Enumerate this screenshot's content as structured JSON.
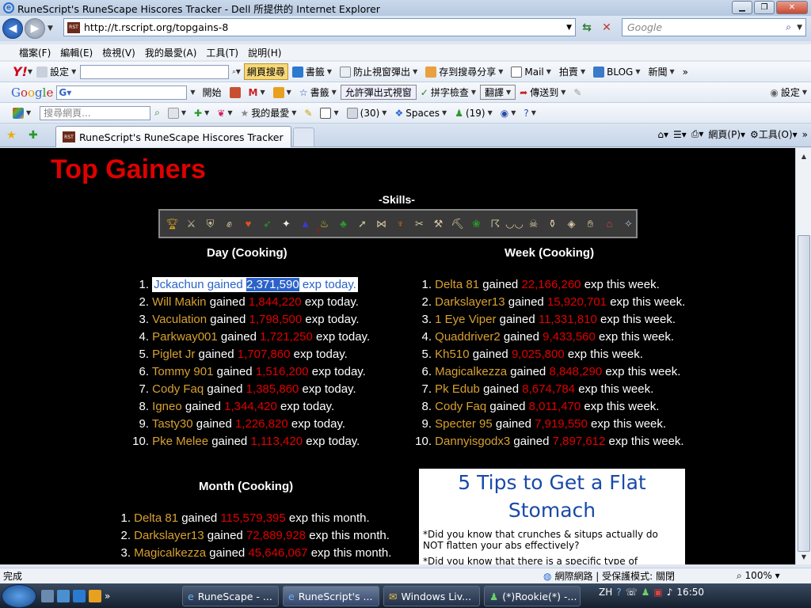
{
  "window": {
    "title": "RuneScript's RuneScape Hiscores Tracker - Dell 所提供的 Internet Explorer"
  },
  "address": {
    "url": "http://t.rscript.org/topgains-8",
    "search_placeholder": "Google"
  },
  "menu": [
    "檔案(F)",
    "編輯(E)",
    "檢視(V)",
    "我的最愛(A)",
    "工具(T)",
    "說明(H)"
  ],
  "toolbar1": {
    "settings": "設定",
    "search_btn": "網頁搜尋",
    "bookmarks": "書籤",
    "popup": "防止視窗彈出",
    "save_search": "存到搜尋分享",
    "mail": "Mail",
    "auction": "拍賣",
    "blog": "BLOG",
    "news": "新聞"
  },
  "toolbar2": {
    "go": "開始",
    "bookmarks": "書籤",
    "allow_popup": "允許彈出式視窗",
    "spell": "拼字檢查",
    "translate": "翻譯",
    "send": "傳送到",
    "settings": "設定"
  },
  "toolbar3": {
    "search_placeholder": "搜尋網頁...",
    "favorites": "我的最愛",
    "count1": "(30)",
    "spaces": "Spaces",
    "count2": "(19)"
  },
  "tab": {
    "title": "RuneScript's RuneScape Hiscores Tracker"
  },
  "cmdbar": {
    "page": "網頁(P)",
    "tools": "工具(O)"
  },
  "page": {
    "title": "Top Gainers",
    "skills_label": "-Skills-",
    "day": {
      "heading": "Day (Cooking)",
      "rows": [
        {
          "n": "1.",
          "name": "Jckachun",
          "val": "2,371,590",
          "suffix": "exp today."
        },
        {
          "n": "2.",
          "name": "Will Makin",
          "val": "1,844,220",
          "suffix": "exp today."
        },
        {
          "n": "3.",
          "name": "Vaculation",
          "val": "1,798,500",
          "suffix": "exp today."
        },
        {
          "n": "4.",
          "name": "Parkway001",
          "val": "1,721,250",
          "suffix": "exp today."
        },
        {
          "n": "5.",
          "name": "Piglet Jr",
          "val": "1,707,860",
          "suffix": "exp today."
        },
        {
          "n": "6.",
          "name": "Tommy 901",
          "val": "1,516,200",
          "suffix": "exp today."
        },
        {
          "n": "7.",
          "name": "Cody Faq",
          "val": "1,385,860",
          "suffix": "exp today."
        },
        {
          "n": "8.",
          "name": "Igneo",
          "val": "1,344,420",
          "suffix": "exp today."
        },
        {
          "n": "9.",
          "name": "Tasty30",
          "val": "1,226,820",
          "suffix": "exp today."
        },
        {
          "n": "10.",
          "name": "Pke Melee",
          "val": "1,113,420",
          "suffix": "exp today."
        }
      ]
    },
    "week": {
      "heading": "Week (Cooking)",
      "rows": [
        {
          "n": "1.",
          "name": "Delta 81",
          "val": "22,166,260",
          "suffix": "exp this week."
        },
        {
          "n": "2.",
          "name": "Darkslayer13",
          "val": "15,920,701",
          "suffix": "exp this week."
        },
        {
          "n": "3.",
          "name": "1 Eye Viper",
          "val": "11,331,810",
          "suffix": "exp this week."
        },
        {
          "n": "4.",
          "name": "Quaddriver2",
          "val": "9,433,560",
          "suffix": "exp this week."
        },
        {
          "n": "5.",
          "name": "Kh510",
          "val": "9,025,800",
          "suffix": "exp this week."
        },
        {
          "n": "6.",
          "name": "Magicalkezza",
          "val": "8,848,290",
          "suffix": "exp this week."
        },
        {
          "n": "7.",
          "name": "Pk Edub",
          "val": "8,674,784",
          "suffix": "exp this week."
        },
        {
          "n": "8.",
          "name": "Cody Faq",
          "val": "8,011,470",
          "suffix": "exp this week."
        },
        {
          "n": "9.",
          "name": "Specter 95",
          "val": "7,919,550",
          "suffix": "exp this week."
        },
        {
          "n": "10.",
          "name": "Dannyisgodx3",
          "val": "7,897,612",
          "suffix": "exp this week."
        }
      ]
    },
    "month": {
      "heading": "Month (Cooking)",
      "rows": [
        {
          "n": "1.",
          "name": "Delta 81",
          "val": "115,579,395",
          "suffix": "exp this month."
        },
        {
          "n": "2.",
          "name": "Darkslayer13",
          "val": "72,889,928",
          "suffix": "exp this month."
        },
        {
          "n": "3.",
          "name": "Magicalkezza",
          "val": "45,646,067",
          "suffix": "exp this month."
        }
      ]
    },
    "gained": "gained",
    "ad": {
      "title": "5 Tips to Get a Flat Stomach",
      "p1": "*Did you know that crunches & situps actually do NOT flatten your abs effectively?",
      "p2": "*Did you know that there is a specific type of"
    }
  },
  "status": {
    "text": "完成",
    "zone": "網際網路 | 受保護模式: 關閉",
    "zoom": "100%"
  },
  "taskbar": {
    "tasks": [
      "RuneScape - ...",
      "RuneScript's ...",
      "Windows Liv...",
      "(*)Rookie(*) -..."
    ],
    "lang": "ZH",
    "clock": "16:50"
  }
}
